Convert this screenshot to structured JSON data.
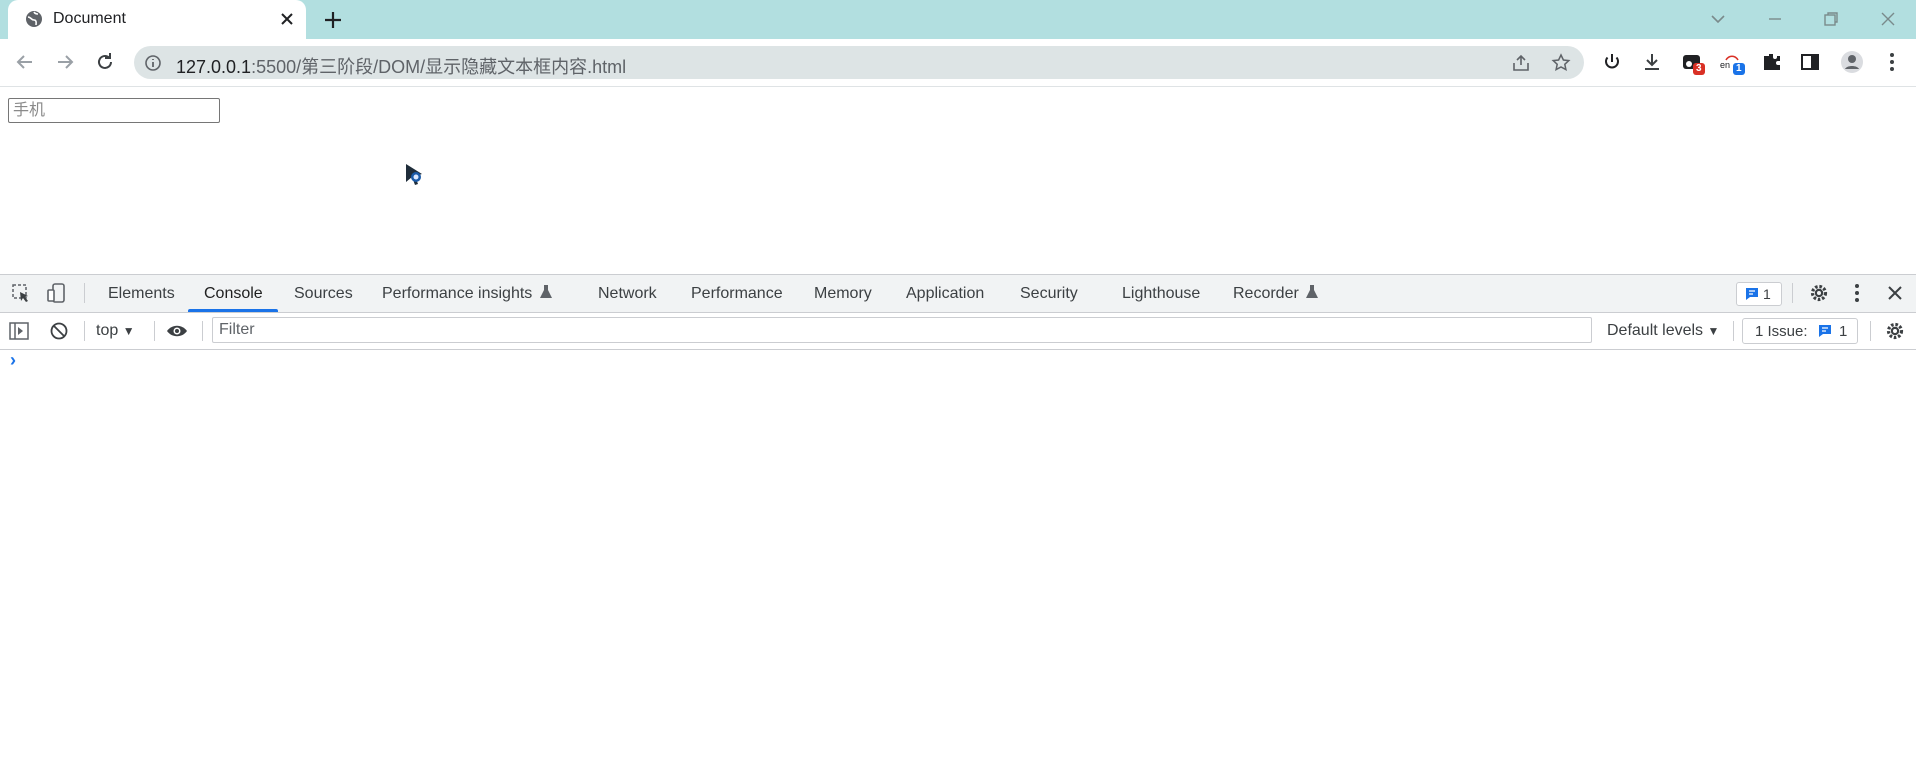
{
  "browser": {
    "tab": {
      "title": "Document"
    },
    "address": {
      "host": "127.0.0.1",
      "path": ":5500/第三阶段/DOM/显示隐藏文本框内容.html"
    },
    "extension_badges": {
      "first": "3",
      "second": "1"
    },
    "extension_label": "en"
  },
  "page": {
    "phone_input": {
      "placeholder": "手机",
      "value": ""
    }
  },
  "devtools": {
    "tabs": [
      "Elements",
      "Console",
      "Sources",
      "Performance insights",
      "Network",
      "Performance",
      "Memory",
      "Application",
      "Security",
      "Lighthouse",
      "Recorder"
    ],
    "active_tab": "Console",
    "message_count": "1",
    "console": {
      "context": "top",
      "filter_placeholder": "Filter",
      "levels": "Default levels",
      "issues_label": "1 Issue:",
      "issues_count": "1",
      "prompt": "›"
    }
  },
  "colors": {
    "tabstrip": "#b2dfe0",
    "omnibox": "#dde4e5",
    "accent": "#1a73e8",
    "badge_red": "#d93025",
    "badge_blue": "#1a73e8"
  },
  "icons": [
    "globe-icon",
    "close-icon",
    "plus-icon",
    "chevron-down-icon",
    "minimize-icon",
    "restore-icon",
    "back-arrow-icon",
    "forward-arrow-icon",
    "reload-icon",
    "info-icon",
    "share-icon",
    "star-icon",
    "power-icon",
    "download-icon",
    "puzzle-icon",
    "side-panel-icon",
    "profile-icon",
    "kebab-icon",
    "inspect-icon",
    "device-toggle-icon",
    "gear-icon",
    "sidebar-toggle-icon",
    "clear-console-icon",
    "eye-icon",
    "flask-icon",
    "message-icon"
  ]
}
